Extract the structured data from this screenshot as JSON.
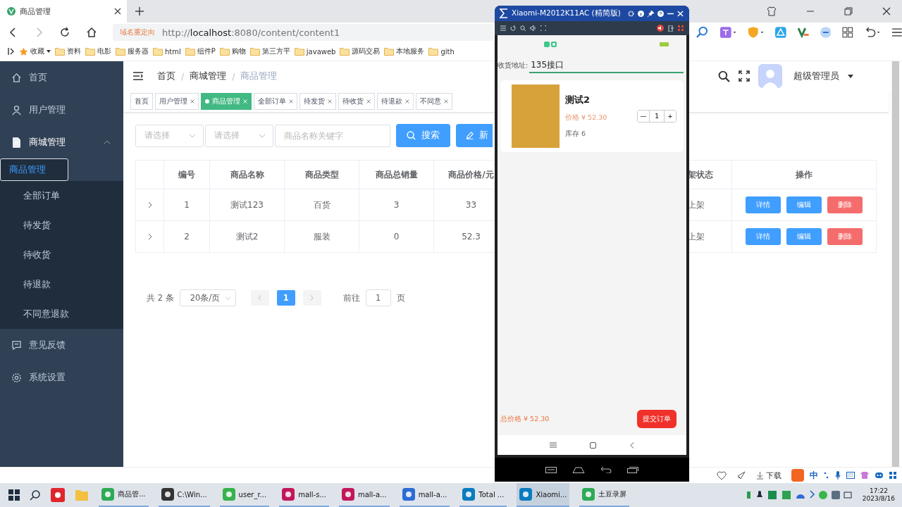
{
  "browser": {
    "tab_title": "商品管理",
    "redirect_badge": "域名重定向",
    "url": "http://**localhost**:8080/content/content1",
    "bookmarks": [
      "收藏",
      "资料",
      "电影",
      "服务器",
      "html",
      "组件P",
      "购物",
      "第三方平",
      "javaweb",
      "源码交易",
      "本地服务",
      "gith"
    ]
  },
  "sidebar": {
    "items": [
      {
        "label": "首页",
        "selected": false
      },
      {
        "label": "用户管理",
        "selected": false
      },
      {
        "label": "商城管理",
        "selected": false,
        "expanded": true,
        "children": [
          {
            "label": "商品管理",
            "selected": true
          },
          {
            "label": "全部订单",
            "selected": false
          },
          {
            "label": "待发货",
            "selected": false
          },
          {
            "label": "待收货",
            "selected": false
          },
          {
            "label": "待退款",
            "selected": false
          },
          {
            "label": "不同意退款",
            "selected": false
          }
        ]
      },
      {
        "label": "意见反馈",
        "selected": false
      },
      {
        "label": "系统设置",
        "selected": false
      }
    ]
  },
  "breadcrumb": {
    "items": [
      "首页",
      "商城管理",
      "商品管理"
    ],
    "separator": "/"
  },
  "user": {
    "name": "超级管理员"
  },
  "tags": [
    {
      "label": "首页",
      "selected": false,
      "closable": false
    },
    {
      "label": "用户管理",
      "selected": false,
      "closable": true
    },
    {
      "label": "商品管理",
      "selected": true,
      "closable": true
    },
    {
      "label": "全部订单",
      "selected": false,
      "closable": true
    },
    {
      "label": "待发货",
      "selected": false,
      "closable": true
    },
    {
      "label": "待收货",
      "selected": false,
      "closable": true
    },
    {
      "label": "待退款",
      "selected": false,
      "closable": true
    },
    {
      "label": "不同意",
      "selected": false,
      "closable": true
    }
  ],
  "filters": {
    "select_1": {
      "placeholder": "请选择"
    },
    "select_2": {
      "placeholder": "请选择"
    },
    "keyword": {
      "placeholder": "商品名称关键字"
    },
    "search_button": "搜索",
    "add_button": "新"
  },
  "table": {
    "columns": [
      "编号",
      "商品名称",
      "商品类型",
      "商品总销量",
      "商品价格/元",
      "架状态",
      "操作"
    ],
    "rows": [
      {
        "cells": [
          "1",
          "测试123",
          "百货",
          "3",
          "33"
        ],
        "status": "上架",
        "actions": [
          {
            "label": "详情",
            "kind": "primary"
          },
          {
            "label": "编辑",
            "kind": "primary"
          },
          {
            "label": "删除",
            "kind": "danger"
          }
        ]
      },
      {
        "cells": [
          "2",
          "测试2",
          "服装",
          "0",
          "52.3"
        ],
        "status": "上架",
        "actions": [
          {
            "label": "详情",
            "kind": "primary"
          },
          {
            "label": "编辑",
            "kind": "primary"
          },
          {
            "label": "删除",
            "kind": "danger"
          }
        ]
      }
    ]
  },
  "pagination": {
    "total": "共 2 条",
    "page_size": "20条/页",
    "pages": [
      {
        "label": "1",
        "selected": true
      }
    ],
    "goto_label": "前往",
    "goto_value": "1",
    "goto_suffix": "页"
  },
  "phone": {
    "title": "Xiaomi-M2012K11AC (精简版)",
    "address_label": "收货地址:",
    "address_value": "135接口",
    "item": {
      "name": "测试2",
      "price": "价格 ¥ 52.30",
      "stock": "库存 6",
      "quantity": "1",
      "minus": "—",
      "plus": "+"
    },
    "total": "总价格 ¥ 52.30",
    "submit": "提交订单"
  },
  "status_bar": {
    "download": "下载",
    "ime": "中"
  },
  "taskbar": {
    "apps": [
      {
        "label": "商品管...",
        "selected": false
      },
      {
        "label": "C:\\Win...",
        "selected": false
      },
      {
        "label": "user_r...",
        "selected": false
      },
      {
        "label": "mall-s...",
        "selected": false
      },
      {
        "label": "mall-a...",
        "selected": false
      },
      {
        "label": "mall-a...",
        "selected": false
      },
      {
        "label": "Total ...",
        "selected": false
      },
      {
        "label": "Xiaomi...",
        "selected": true
      },
      {
        "label": "土豆录屏",
        "selected": false
      }
    ],
    "time": "17:22",
    "date": "2023/8/16"
  }
}
